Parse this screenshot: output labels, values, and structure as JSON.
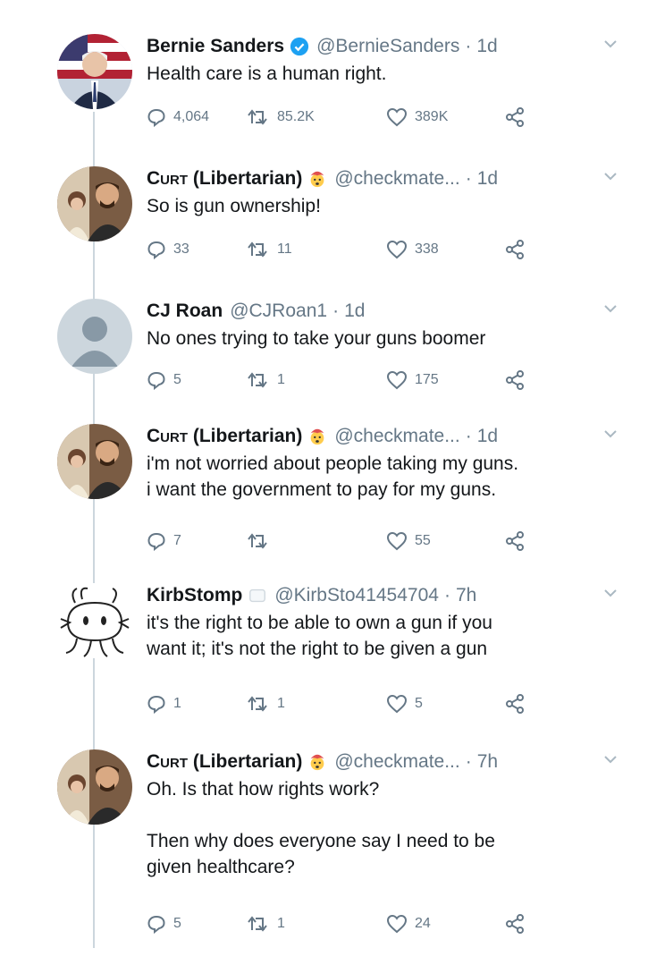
{
  "tweets": [
    {
      "name": "Bernie Sanders",
      "verified": true,
      "handle": "@BernieSanders",
      "time": "1d",
      "text": "Health care is a human right.",
      "reply_count": "4,064",
      "retweet_count": "85.2K",
      "like_count": "389K",
      "avatar": "bernie-photo"
    },
    {
      "name_prefix": "Curt",
      "name_suffix": " (Libertarian)",
      "emoji": "exploding-head-emoji",
      "handle": "@checkmate...",
      "time": "1d",
      "text": "So is gun ownership!",
      "reply_count": "33",
      "retweet_count": "11",
      "like_count": "338",
      "avatar": "curt-photo"
    },
    {
      "name": "CJ Roan",
      "handle": "@CJRoan1",
      "time": "1d",
      "text": "No ones trying to take your guns boomer",
      "reply_count": "5",
      "retweet_count": "1",
      "like_count": "175",
      "avatar": "default-avatar"
    },
    {
      "name_prefix": "Curt",
      "name_suffix": " (Libertarian)",
      "emoji": "exploding-head-emoji",
      "handle": "@checkmate...",
      "time": "1d",
      "text": "i'm not worried about people taking my guns.\ni want the government to pay for my guns.",
      "reply_count": "7",
      "retweet_count": "",
      "like_count": "55",
      "avatar": "curt-photo"
    },
    {
      "name": "KirbStomp",
      "handle": "@KirbSto41454704",
      "time": "7h",
      "text": "it's the right to be able to own a gun if you\nwant it; it's not the right to be given a gun",
      "reply_count": "1",
      "retweet_count": "1",
      "like_count": "5",
      "avatar": "kirby-drawing"
    },
    {
      "name_prefix": "Curt",
      "name_suffix": " (Libertarian)",
      "emoji": "exploding-head-emoji",
      "handle": "@checkmate...",
      "time": "7h",
      "text": "Oh. Is that how rights work?\n\nThen why does everyone say I need to be\ngiven healthcare?",
      "reply_count": "5",
      "retweet_count": "1",
      "like_count": "24",
      "avatar": "curt-photo"
    }
  ],
  "colors": {
    "text": "#14171a",
    "secondary": "#657786",
    "verified": "#1da1f2",
    "thread_line": "#ccd6dd"
  }
}
